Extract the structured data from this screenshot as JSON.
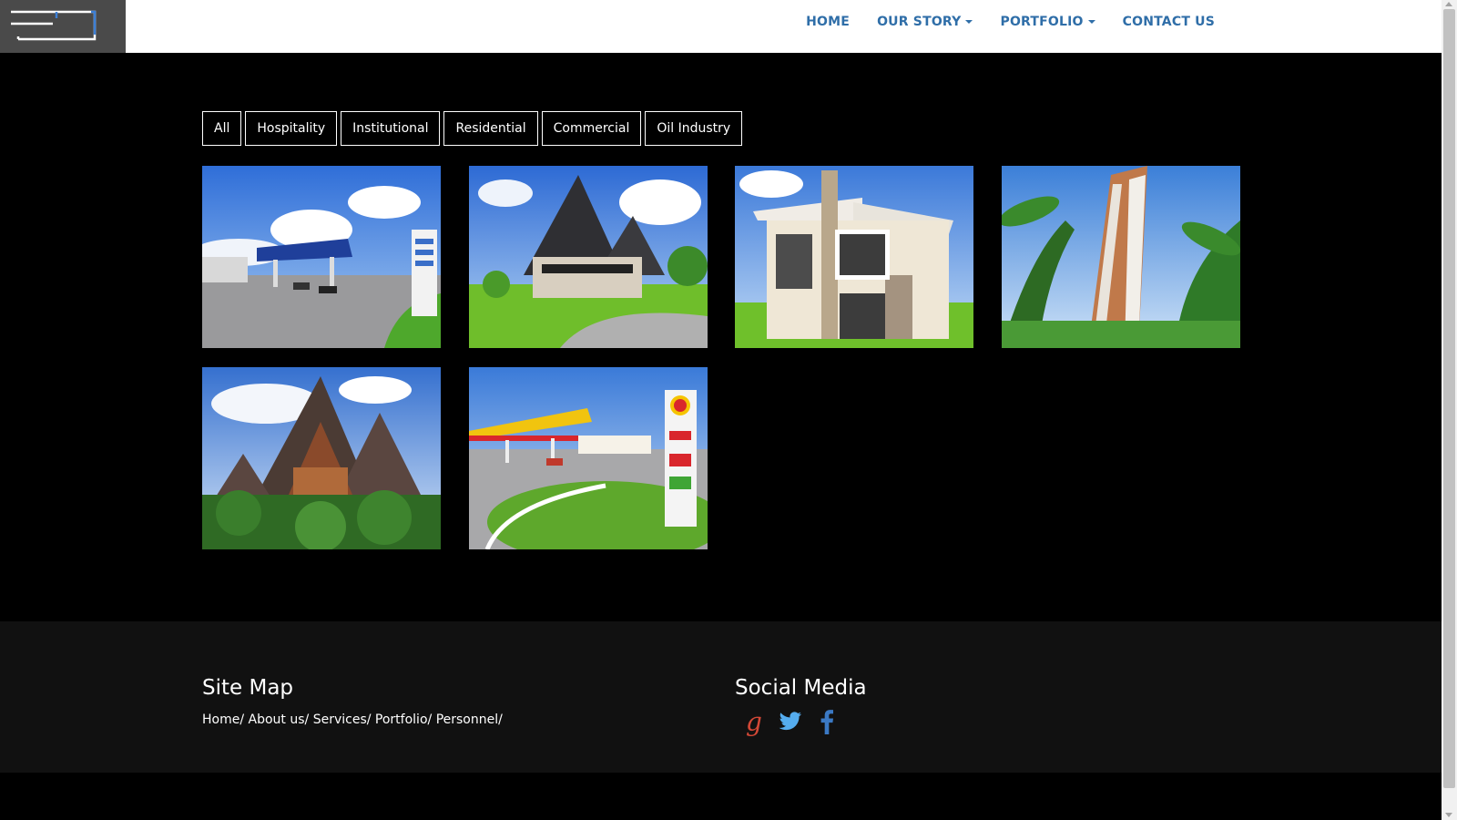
{
  "nav": {
    "items": [
      {
        "label": "HOME",
        "dropdown": false
      },
      {
        "label": "OUR STORY",
        "dropdown": true
      },
      {
        "label": "PORTFOLIO",
        "dropdown": true
      },
      {
        "label": "CONTACT US",
        "dropdown": false
      }
    ]
  },
  "filters": [
    "All",
    "Hospitality",
    "Institutional",
    "Residential",
    "Commercial",
    "Oil Industry"
  ],
  "gallery": [
    {
      "subject": "petrol-station-render"
    },
    {
      "subject": "a-frame-villa-render"
    },
    {
      "subject": "modern-house-render"
    },
    {
      "subject": "highrise-tower-render"
    },
    {
      "subject": "a-frame-lodge-render"
    },
    {
      "subject": "shell-station-render"
    }
  ],
  "footer": {
    "sitemap_title": "Site Map",
    "sitemap_links": [
      "Home",
      "About us",
      "Services",
      "Portfolio",
      "Personnel"
    ],
    "social_title": "Social Media",
    "social": [
      {
        "icon": "google-plus-icon",
        "color": "#d34836"
      },
      {
        "icon": "twitter-icon",
        "color": "#55acee"
      },
      {
        "icon": "facebook-icon",
        "color": "#3b5998"
      }
    ]
  },
  "colors": {
    "nav_text": "#2f6ea8",
    "background": "#000000",
    "footer_bg": "#111111",
    "header_bg": "#ffffff",
    "logo_bg": "#4a4a4a"
  }
}
